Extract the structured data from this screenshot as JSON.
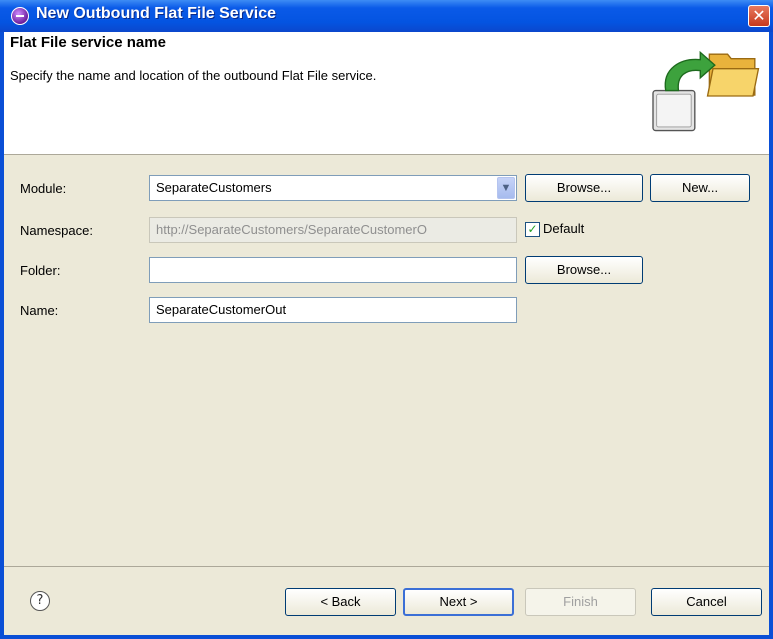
{
  "window": {
    "title": "New Outbound Flat File Service",
    "close_glyph": "✕"
  },
  "banner": {
    "title": "Flat File service name",
    "description": "Specify the name and location of the outbound Flat File service."
  },
  "form": {
    "module": {
      "label": "Module:",
      "value": "SeparateCustomers",
      "browse": "Browse...",
      "new": "New..."
    },
    "namespace": {
      "label": "Namespace:",
      "value": "http://SeparateCustomers/SeparateCustomerO",
      "default_label": "Default",
      "default_checked": true
    },
    "folder": {
      "label": "Folder:",
      "value": "",
      "browse": "Browse..."
    },
    "name": {
      "label": "Name:",
      "value": "SeparateCustomerOut"
    }
  },
  "footer": {
    "help_glyph": "?",
    "back": "< Back",
    "next": "Next >",
    "finish": "Finish",
    "cancel": "Cancel"
  },
  "colors": {
    "titlebar": "#0454e1",
    "dialog_bg": "#ece9d8",
    "check_mark": "#21a121"
  },
  "icons": {
    "app": "eclipse-app-icon",
    "wizard": "folder-export-icon",
    "help": "help-icon",
    "dropdown": "chevron-down-icon"
  }
}
